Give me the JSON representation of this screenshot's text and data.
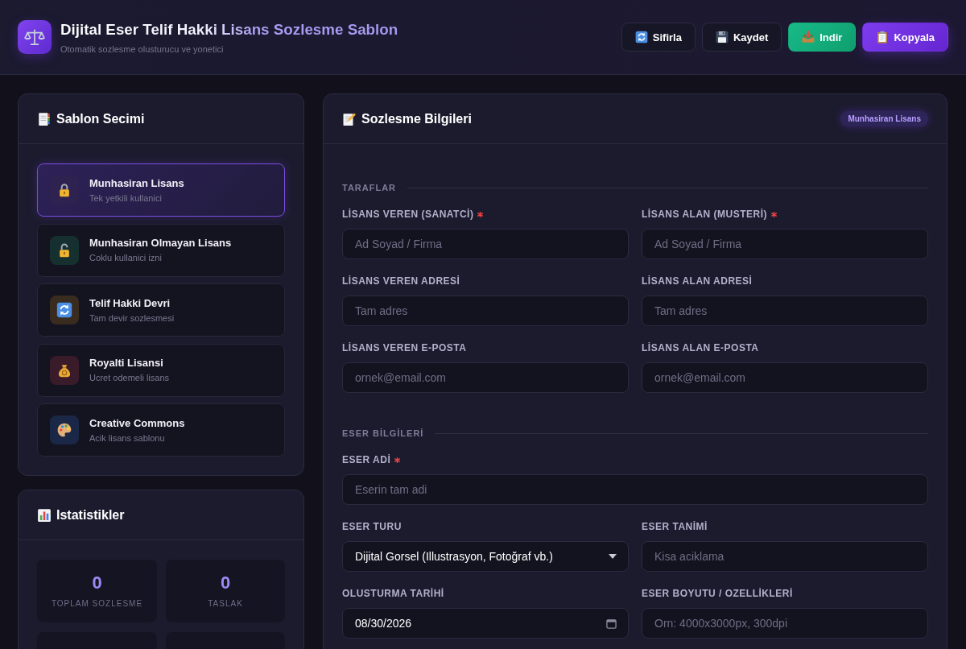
{
  "header": {
    "title": "Dijital Eser Telif Hakki Lisans Sozlesme Sablon",
    "subtitle": "Otomatik sozlesme olusturucu ve yonetici",
    "actions": [
      {
        "label": "Sifirla",
        "kind": "ghost"
      },
      {
        "label": "Kaydet",
        "kind": "ghost"
      },
      {
        "label": "Indir",
        "kind": "success"
      },
      {
        "label": "Kopyala",
        "kind": "primary"
      }
    ]
  },
  "templates": {
    "title": "Sablon Secimi",
    "items": [
      {
        "name": "Munhasiran Lisans",
        "description": "Tek yetkili kullanici",
        "color": "#2e2350",
        "selected": true
      },
      {
        "name": "Munhasiran Olmayan Lisans",
        "description": "Coklu kullanici izni",
        "color": "#15302e",
        "selected": false
      },
      {
        "name": "Telif Hakki Devri",
        "description": "Tam devir sozlesmesi",
        "color": "#3a2b1f",
        "selected": false
      },
      {
        "name": "Royalti Lisansi",
        "description": "Ucret odemeli lisans",
        "color": "#3a1b29",
        "selected": false
      },
      {
        "name": "Creative Commons",
        "description": "Acik lisans sablonu",
        "color": "#1b2746",
        "selected": false
      }
    ]
  },
  "stats": {
    "title": "Istatistikler",
    "items": [
      {
        "value": "0",
        "label": "TOPLAM SOZLESME"
      },
      {
        "value": "0",
        "label": "TASLAK"
      }
    ]
  },
  "form": {
    "title": "Sozlesme Bilgileri",
    "badge": "Munhasiran Lisans",
    "sections": [
      {
        "title": "TARAFLAR",
        "rows": [
          [
            {
              "label": "LİSANS VEREN (SANATCİ)",
              "required": true,
              "kind": "text",
              "placeholder": "Ad Soyad / Firma"
            },
            {
              "label": "LİSANS ALAN (MUSTERİ)",
              "required": true,
              "kind": "text",
              "placeholder": "Ad Soyad / Firma"
            }
          ],
          [
            {
              "label": "LİSANS VEREN ADRESİ",
              "required": false,
              "kind": "text",
              "placeholder": "Tam adres"
            },
            {
              "label": "LİSANS ALAN ADRESİ",
              "required": false,
              "kind": "text",
              "placeholder": "Tam adres"
            }
          ],
          [
            {
              "label": "LİSANS VEREN E-POSTA",
              "required": false,
              "kind": "text",
              "placeholder": "ornek@email.com"
            },
            {
              "label": "LİSANS ALAN E-POSTA",
              "required": false,
              "kind": "text",
              "placeholder": "ornek@email.com"
            }
          ]
        ]
      },
      {
        "title": "ESER BİLGİLERİ",
        "rows": [
          [
            {
              "label": "ESER ADİ",
              "required": true,
              "kind": "text",
              "placeholder": "Eserin tam adi"
            }
          ],
          [
            {
              "label": "ESER TURU",
              "required": false,
              "kind": "select",
              "value": "Dijital Gorsel (Illustrasyon, Fotoğraf vb.)"
            },
            {
              "label": "ESER TANİMİ",
              "required": false,
              "kind": "text",
              "placeholder": "Kisa aciklama"
            }
          ],
          [
            {
              "label": "OLUSTURMA TARİHİ",
              "required": false,
              "kind": "date",
              "value": "08/30/2026"
            },
            {
              "label": "ESER BOYUTU / OZELLİKLERİ",
              "required": false,
              "kind": "text",
              "placeholder": "Orn: 4000x3000px, 300dpi"
            }
          ]
        ]
      }
    ]
  }
}
